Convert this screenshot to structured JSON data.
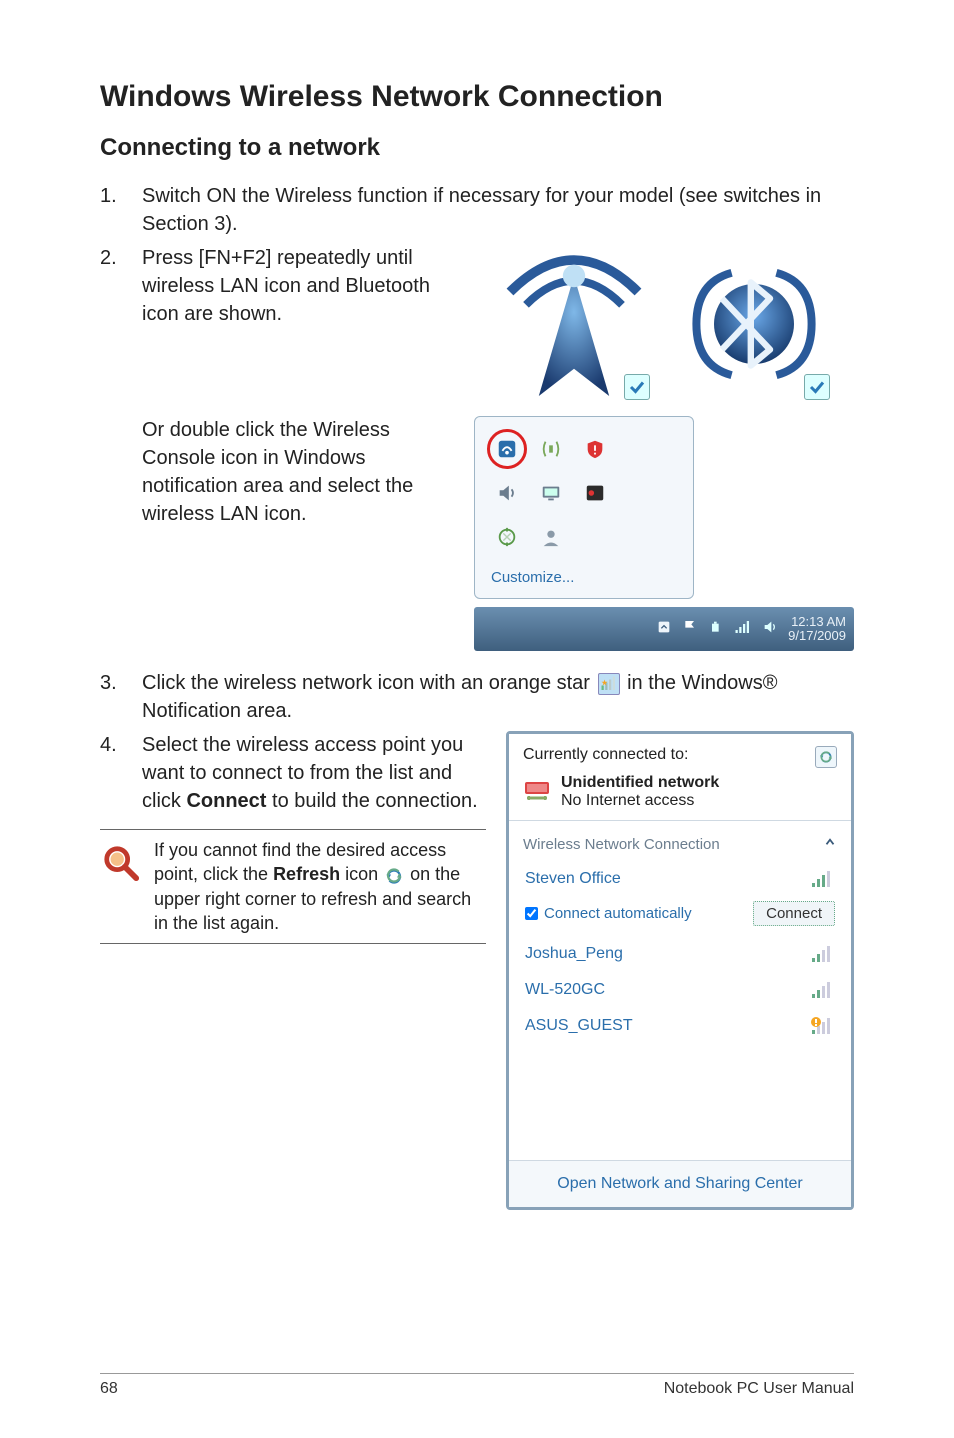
{
  "heading": "Windows Wireless Network Connection",
  "subheading": "Connecting to a network",
  "step1": {
    "num": "1.",
    "text": "Switch ON the Wireless function if necessary for your model (see switches in Section 3)."
  },
  "step2": {
    "num": "2.",
    "text": "Press [FN+F2] repeatedly until wireless LAN icon and Bluetooth icon are shown."
  },
  "or_text": "Or double click the Wireless Console icon in Windows notification area and select the wireless LAN icon.",
  "systray": {
    "customize": "Customize...",
    "clock_time": "12:13 AM",
    "clock_date": "9/17/2009"
  },
  "step3": {
    "num": "3.",
    "before": "Click the wireless network icon with an orange star ",
    "after": " in the Windows® Notification area."
  },
  "step4": {
    "num": "4.",
    "text_before": "Select the wireless access point you want to connect to from the list and click ",
    "bold": "Connect",
    "text_after": " to build the connection."
  },
  "callout": {
    "before": "If you cannot find the desired access point, click the ",
    "bold": "Refresh",
    "mid": " icon ",
    "after": " on the upper right corner to refresh and search in the list again."
  },
  "wifi": {
    "currently": "Currently connected to:",
    "unidentified": "Unidentified network",
    "no_access": "No Internet access",
    "section": "Wireless Network Connection",
    "items": [
      "Steven Office",
      "Joshua_Peng",
      "WL-520GC",
      "ASUS_GUEST"
    ],
    "auto": "Connect automatically",
    "connect": "Connect",
    "footer": "Open Network and Sharing Center"
  },
  "footer": {
    "page": "68",
    "label": "Notebook PC User Manual"
  }
}
